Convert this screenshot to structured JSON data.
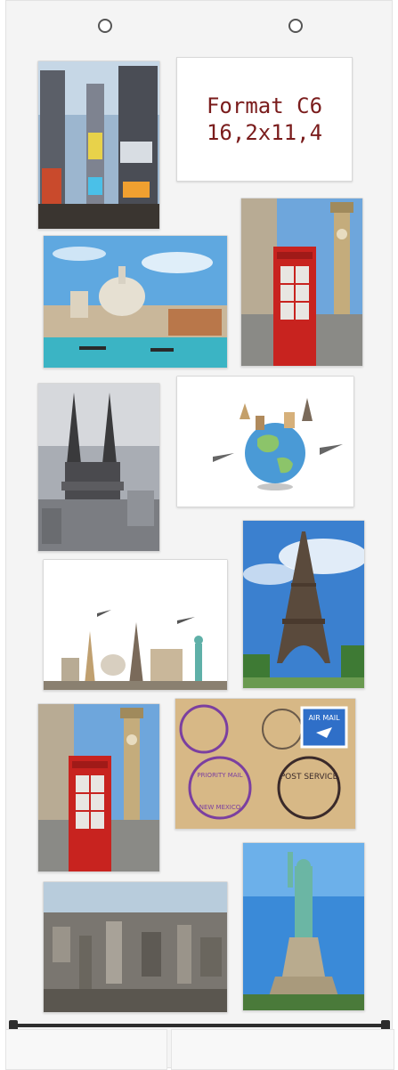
{
  "label": {
    "line1": "Format C6",
    "line2": "16,2x11,4"
  },
  "colors": {
    "label_text": "#7a1c1c",
    "phone_box_red": "#c8231f",
    "sky_blue": "#3b8ad8"
  },
  "photos": [
    "times-square-photo",
    "venice-photo",
    "london-phone-box-photo",
    "cologne-cathedral-photo",
    "travel-globe-illustration",
    "world-landmarks-illustration",
    "eiffel-tower-photo",
    "london-phone-box-photo-2",
    "postage-stamps-photo",
    "city-aerial-photo",
    "statue-of-liberty-photo"
  ],
  "stamps": {
    "air_mail": "AIR MAIL",
    "post_service": "POST SERVICE",
    "priority_mail": "PRIORITY MAIL",
    "new_mexico": "NEW MEXICO"
  }
}
